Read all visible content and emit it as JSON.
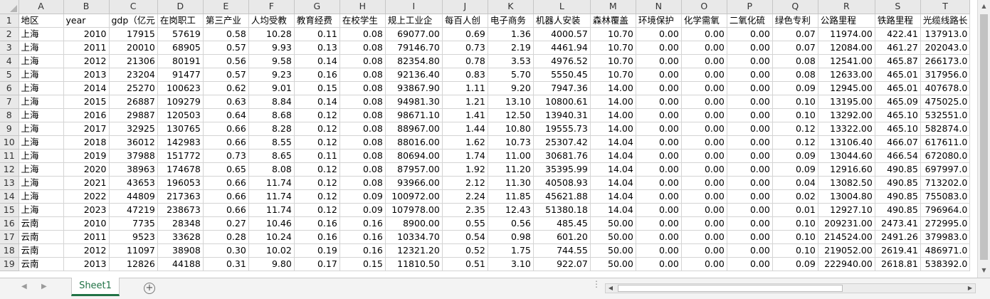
{
  "columns": [
    "A",
    "B",
    "C",
    "D",
    "E",
    "F",
    "G",
    "H",
    "I",
    "J",
    "K",
    "L",
    "M",
    "N",
    "O",
    "P",
    "Q",
    "R",
    "S",
    "T"
  ],
  "header_row": [
    "地区",
    "year",
    "gdp（亿元",
    "在岗职工",
    "第三产业",
    "人均受教",
    "教育经费",
    "在校学生",
    "规上工业企",
    "每百人创",
    "电子商务",
    "机器人安装",
    "森林覆盖",
    "环境保护",
    "化学需氧",
    "二氧化硫",
    "绿色专利",
    "公路里程",
    "铁路里程",
    "光缆线路长"
  ],
  "rows": [
    [
      "上海",
      "2010",
      "17915",
      "57619",
      "0.58",
      "10.28",
      "0.11",
      "0.08",
      "69077.00",
      "0.69",
      "1.36",
      "4000.57",
      "10.70",
      "0.00",
      "0.00",
      "0.00",
      "0.07",
      "11974.00",
      "422.41",
      "137913.0"
    ],
    [
      "上海",
      "2011",
      "20010",
      "68905",
      "0.57",
      "9.93",
      "0.13",
      "0.08",
      "79146.70",
      "0.73",
      "2.19",
      "4461.94",
      "10.70",
      "0.00",
      "0.00",
      "0.00",
      "0.07",
      "12084.00",
      "461.27",
      "202043.0"
    ],
    [
      "上海",
      "2012",
      "21306",
      "80191",
      "0.56",
      "9.58",
      "0.14",
      "0.08",
      "82354.80",
      "0.78",
      "3.53",
      "4976.52",
      "10.70",
      "0.00",
      "0.00",
      "0.00",
      "0.08",
      "12541.00",
      "465.87",
      "266173.0"
    ],
    [
      "上海",
      "2013",
      "23204",
      "91477",
      "0.57",
      "9.23",
      "0.16",
      "0.08",
      "92136.40",
      "0.83",
      "5.70",
      "5550.45",
      "10.70",
      "0.00",
      "0.00",
      "0.00",
      "0.08",
      "12633.00",
      "465.01",
      "317956.0"
    ],
    [
      "上海",
      "2014",
      "25270",
      "100623",
      "0.62",
      "9.01",
      "0.15",
      "0.08",
      "93867.90",
      "1.11",
      "9.20",
      "7947.36",
      "14.00",
      "0.00",
      "0.00",
      "0.00",
      "0.09",
      "12945.00",
      "465.01",
      "407678.0"
    ],
    [
      "上海",
      "2015",
      "26887",
      "109279",
      "0.63",
      "8.84",
      "0.14",
      "0.08",
      "94981.30",
      "1.21",
      "13.10",
      "10800.61",
      "14.00",
      "0.00",
      "0.00",
      "0.00",
      "0.10",
      "13195.00",
      "465.09",
      "475025.0"
    ],
    [
      "上海",
      "2016",
      "29887",
      "120503",
      "0.64",
      "8.68",
      "0.12",
      "0.08",
      "98671.10",
      "1.41",
      "12.50",
      "13940.31",
      "14.00",
      "0.00",
      "0.00",
      "0.00",
      "0.10",
      "13292.00",
      "465.10",
      "532551.0"
    ],
    [
      "上海",
      "2017",
      "32925",
      "130765",
      "0.66",
      "8.28",
      "0.12",
      "0.08",
      "88967.00",
      "1.44",
      "10.80",
      "19555.73",
      "14.00",
      "0.00",
      "0.00",
      "0.00",
      "0.12",
      "13322.00",
      "465.10",
      "582874.0"
    ],
    [
      "上海",
      "2018",
      "36012",
      "142983",
      "0.66",
      "8.55",
      "0.12",
      "0.08",
      "88016.00",
      "1.62",
      "10.73",
      "25307.42",
      "14.04",
      "0.00",
      "0.00",
      "0.00",
      "0.12",
      "13106.40",
      "466.07",
      "617611.0"
    ],
    [
      "上海",
      "2019",
      "37988",
      "151772",
      "0.73",
      "8.65",
      "0.11",
      "0.08",
      "80694.00",
      "1.74",
      "11.00",
      "30681.76",
      "14.04",
      "0.00",
      "0.00",
      "0.00",
      "0.09",
      "13044.60",
      "466.54",
      "672080.0"
    ],
    [
      "上海",
      "2020",
      "38963",
      "174678",
      "0.65",
      "8.08",
      "0.12",
      "0.08",
      "87957.00",
      "1.92",
      "11.20",
      "35395.99",
      "14.04",
      "0.00",
      "0.00",
      "0.00",
      "0.09",
      "12916.60",
      "490.85",
      "697997.0"
    ],
    [
      "上海",
      "2021",
      "43653",
      "196053",
      "0.66",
      "11.74",
      "0.12",
      "0.08",
      "93966.00",
      "2.12",
      "11.30",
      "40508.93",
      "14.04",
      "0.00",
      "0.00",
      "0.00",
      "0.04",
      "13082.50",
      "490.85",
      "713202.0"
    ],
    [
      "上海",
      "2022",
      "44809",
      "217363",
      "0.66",
      "11.74",
      "0.12",
      "0.09",
      "100972.00",
      "2.24",
      "11.85",
      "45621.88",
      "14.04",
      "0.00",
      "0.00",
      "0.00",
      "0.02",
      "13004.80",
      "490.85",
      "755083.0"
    ],
    [
      "上海",
      "2023",
      "47219",
      "238673",
      "0.66",
      "11.74",
      "0.12",
      "0.09",
      "107978.00",
      "2.35",
      "12.43",
      "51380.18",
      "14.04",
      "0.00",
      "0.00",
      "0.00",
      "0.01",
      "12927.10",
      "490.85",
      "796964.0"
    ],
    [
      "云南",
      "2010",
      "7735",
      "28348",
      "0.27",
      "10.46",
      "0.16",
      "0.16",
      "8900.00",
      "0.55",
      "0.56",
      "485.45",
      "50.00",
      "0.00",
      "0.00",
      "0.00",
      "0.10",
      "209231.00",
      "2473.41",
      "272995.0"
    ],
    [
      "云南",
      "2011",
      "9523",
      "33628",
      "0.28",
      "10.24",
      "0.16",
      "0.16",
      "10334.70",
      "0.54",
      "0.98",
      "601.20",
      "50.00",
      "0.00",
      "0.00",
      "0.00",
      "0.10",
      "214524.00",
      "2491.26",
      "379983.0"
    ],
    [
      "云南",
      "2012",
      "11097",
      "38908",
      "0.30",
      "10.02",
      "0.19",
      "0.16",
      "12321.20",
      "0.52",
      "1.75",
      "744.55",
      "50.00",
      "0.00",
      "0.00",
      "0.00",
      "0.10",
      "219052.00",
      "2619.41",
      "486971.0"
    ],
    [
      "云南",
      "2013",
      "12826",
      "44188",
      "0.31",
      "9.80",
      "0.17",
      "0.15",
      "11810.50",
      "0.51",
      "3.10",
      "922.07",
      "50.00",
      "0.00",
      "0.00",
      "0.00",
      "0.09",
      "222940.00",
      "2618.81",
      "538392.0"
    ]
  ],
  "sheet": {
    "tab_label": "Sheet1",
    "add_label": "+",
    "nav_prev": "◀",
    "nav_next": "▶"
  },
  "scroll": {
    "up": "▲",
    "down": "▼",
    "left": "◀",
    "right": "▶"
  }
}
